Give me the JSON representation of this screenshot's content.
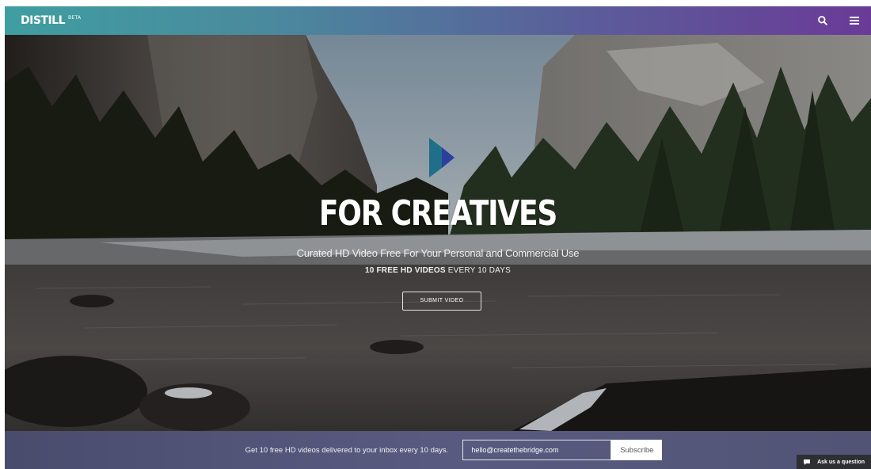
{
  "header": {
    "logo": "DISTILL",
    "beta": "BETA",
    "icons": [
      "search-icon",
      "hamburger-menu-icon"
    ],
    "background_gradient": [
      "#3f9ea1",
      "#6a3a97"
    ]
  },
  "hero": {
    "headline": "FOR CREATIVES",
    "subheadline": "Curated HD Video Free For Your Personal and Commercial Use",
    "offer_bold": "10 FREE HD VIDEOS",
    "offer_rest": " EVERY 10 DAYS",
    "submit_button": "SUBMIT VIDEO",
    "logo_mark": "play-triangle-logo",
    "logo_colors": [
      "#2b3f9c",
      "#3c7bd6",
      "#1f2f7a"
    ]
  },
  "footer": {
    "text": "Get 10 free HD videos delivered to your inbox every 10 days.",
    "email_value": "hello@createthebridge.com",
    "subscribe_button": "Subscribe",
    "help_badge": "Ask us a question",
    "help_icon": "chat-bubble-icon"
  }
}
